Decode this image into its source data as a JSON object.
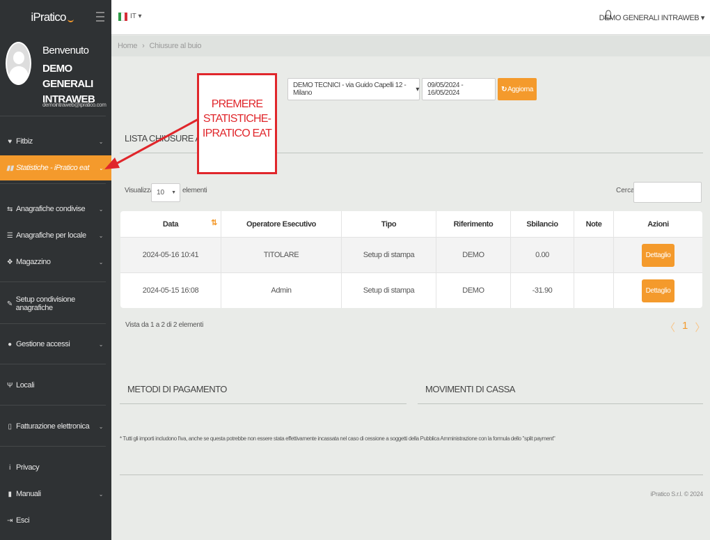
{
  "sidebar": {
    "brand": "iPratico",
    "welcome": "Benvenuto",
    "user_name": "DEMO GENERALI INTRAWEB",
    "user_email": "demointraweb@ipratico.com",
    "items": [
      {
        "label": "Fitbiz",
        "icon": "heart-icon"
      },
      {
        "label": "Statistiche - iPratico eat",
        "icon": "bar-chart-icon"
      },
      {
        "label": "Anagrafiche condivise",
        "icon": "exchange-icon"
      },
      {
        "label": "Anagrafiche per locale",
        "icon": "database-icon"
      },
      {
        "label": "Magazzino",
        "icon": "cubes-icon"
      },
      {
        "label": "Setup condivisione anagrafiche",
        "icon": "wrench-icon"
      },
      {
        "label": "Gestione accessi",
        "icon": "users-icon"
      },
      {
        "label": "Locali",
        "icon": "cutlery-icon"
      },
      {
        "label": "Fatturazione elettronica",
        "icon": "file-icon"
      },
      {
        "label": "Privacy",
        "icon": "info-icon"
      },
      {
        "label": "Manuali",
        "icon": "book-icon"
      },
      {
        "label": "Esci",
        "icon": "sign-out-icon"
      }
    ]
  },
  "topbar": {
    "lang": "IT",
    "user_menu": "DEMO GENERALI INTRAWEB"
  },
  "breadcrumb": {
    "home": "Home",
    "sep": "›",
    "current": "Chiusure al buio"
  },
  "filters": {
    "shop": "DEMO TECNICI - via Guido Capelli 12 - Milano",
    "date_range": "09/05/2024 - 16/05/2024",
    "refresh_label": "Aggiorna"
  },
  "list": {
    "title": "LISTA CHIUSURE AL BUIO",
    "show_label": "Visualizza",
    "page_length": "10",
    "elements_label": "elementi",
    "search_label": "Cerca:",
    "columns": [
      "Data",
      "Operatore Esecutivo",
      "Tipo",
      "Riferimento",
      "Sbilancio",
      "Note",
      "Azioni"
    ],
    "rows": [
      {
        "date": "2024-05-16 10:41",
        "operator": "TITOLARE",
        "type": "Setup di stampa",
        "ref": "DEMO",
        "balance": "0.00",
        "note": "",
        "action": "Dettaglio"
      },
      {
        "date": "2024-05-15 16:08",
        "operator": "Admin",
        "type": "Setup di stampa",
        "ref": "DEMO",
        "balance": "-31.90",
        "note": "",
        "action": "Dettaglio"
      }
    ],
    "info": "Vista da 1 a 2 di 2 elementi",
    "page": "1"
  },
  "sections": {
    "payments": "METODI DI PAGAMENTO",
    "cash": "MOVIMENTI DI CASSA"
  },
  "footnote": "* Tutti gli importi includono l'iva, anche se questa potrebbe non essere stata effettivamente incassata nel caso di cessione a soggetti della Pubblica Amministrazione con la formula dello \"split payment\"",
  "copyright": "iPratico S.r.l. © 2024",
  "annotation": {
    "line1": "PREMERE",
    "line2": "STATISTICHE-",
    "line3": "IPRATICO EAT"
  },
  "colors": {
    "accent": "#f49a2c",
    "sidebar": "#2f3234",
    "annotation": "#e0262b"
  }
}
